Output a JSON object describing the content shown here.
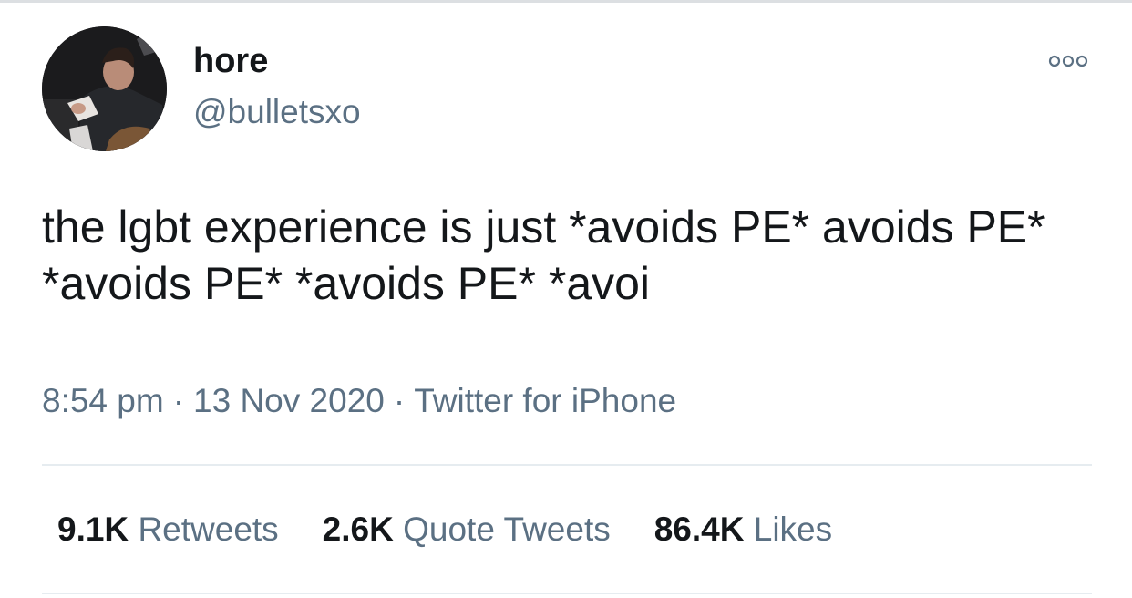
{
  "tweet": {
    "author": {
      "display_name": "hore",
      "handle": "@bulletsxo",
      "avatar_icon": "profile-photo"
    },
    "more_icon": "more-options-icon",
    "text": "the lgbt experience is just *avoids PE* avoids PE* *avoids PE* *avoids PE* *avoi",
    "meta": {
      "time": "8:54 pm",
      "date": "13 Nov 2020",
      "source": "Twitter for iPhone",
      "separator": "·"
    },
    "stats": {
      "retweets": {
        "count": "9.1K",
        "label": "Retweets"
      },
      "quote_tweets": {
        "count": "2.6K",
        "label": "Quote Tweets"
      },
      "likes": {
        "count": "86.4K",
        "label": "Likes"
      }
    },
    "colors": {
      "text_primary": "#14171a",
      "text_secondary": "#5b7083",
      "divider": "#e6ecf0"
    }
  }
}
